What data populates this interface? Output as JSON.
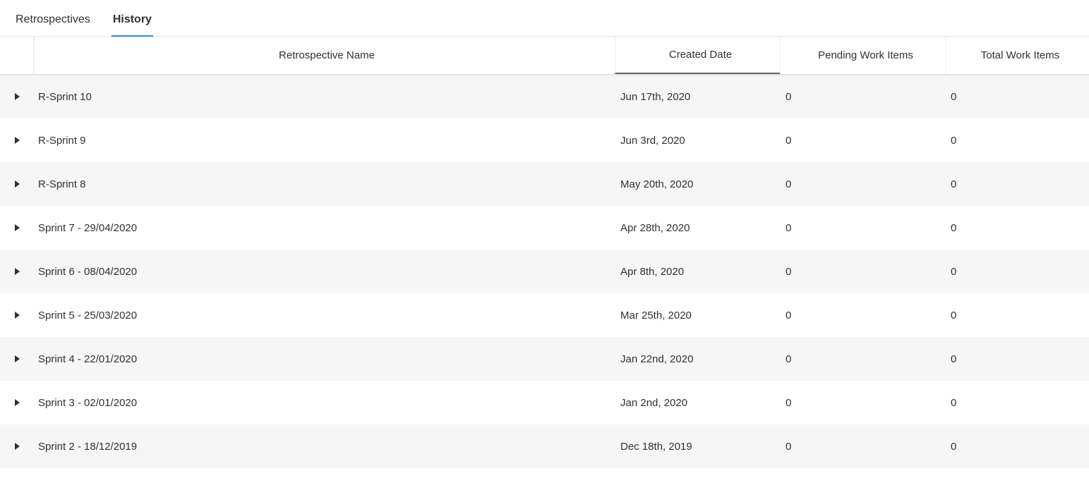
{
  "tabs": [
    {
      "label": "Retrospectives",
      "active": false
    },
    {
      "label": "History",
      "active": true
    }
  ],
  "columns": {
    "name": "Retrospective Name",
    "date": "Created Date",
    "pending": "Pending Work Items",
    "total": "Total Work Items"
  },
  "sorted_column": "date",
  "rows": [
    {
      "name": "R-Sprint 10",
      "date": "Jun 17th, 2020",
      "pending": "0",
      "total": "0"
    },
    {
      "name": "R-Sprint 9",
      "date": "Jun 3rd, 2020",
      "pending": "0",
      "total": "0"
    },
    {
      "name": "R-Sprint 8",
      "date": "May 20th, 2020",
      "pending": "0",
      "total": "0"
    },
    {
      "name": "Sprint 7 - 29/04/2020",
      "date": "Apr 28th, 2020",
      "pending": "0",
      "total": "0"
    },
    {
      "name": "Sprint 6 - 08/04/2020",
      "date": "Apr 8th, 2020",
      "pending": "0",
      "total": "0"
    },
    {
      "name": "Sprint 5 - 25/03/2020",
      "date": "Mar 25th, 2020",
      "pending": "0",
      "total": "0"
    },
    {
      "name": "Sprint 4 - 22/01/2020",
      "date": "Jan 22nd, 2020",
      "pending": "0",
      "total": "0"
    },
    {
      "name": "Sprint 3 - 02/01/2020",
      "date": "Jan 2nd, 2020",
      "pending": "0",
      "total": "0"
    },
    {
      "name": "Sprint 2 - 18/12/2019",
      "date": "Dec 18th, 2019",
      "pending": "0",
      "total": "0"
    }
  ]
}
